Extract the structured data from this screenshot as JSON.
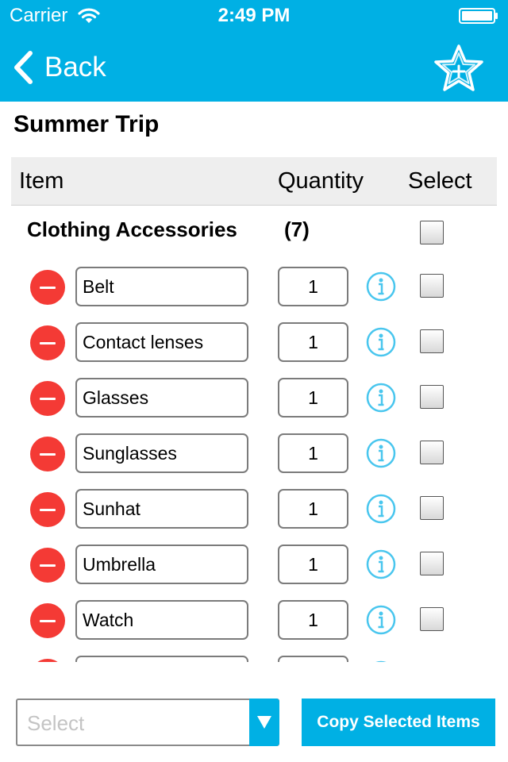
{
  "status_bar": {
    "carrier": "Carrier",
    "time": "2:49 PM",
    "wifi_icon": "wifi-icon",
    "battery_icon": "battery-icon"
  },
  "nav": {
    "back_label": "Back",
    "back_icon": "chevron-left-icon",
    "action_icon": "star-add-icon",
    "accent_color": "#00b0e4"
  },
  "trip": {
    "title": "Summer Trip"
  },
  "columns": {
    "item": "Item",
    "quantity": "Quantity",
    "select": "Select"
  },
  "category": {
    "name": "Clothing Accessories",
    "count": "(7)"
  },
  "items": [
    {
      "name": "Belt",
      "quantity": "1"
    },
    {
      "name": "Contact lenses",
      "quantity": "1"
    },
    {
      "name": "Glasses",
      "quantity": "1"
    },
    {
      "name": "Sunglasses",
      "quantity": "1"
    },
    {
      "name": "Sunhat",
      "quantity": "1"
    },
    {
      "name": "Umbrella",
      "quantity": "1"
    },
    {
      "name": "Watch",
      "quantity": "1"
    },
    {
      "name": "",
      "quantity": ""
    }
  ],
  "footer": {
    "select_placeholder": "Select",
    "copy_label": "Copy Selected Items",
    "delete_color": "#f43a35"
  }
}
